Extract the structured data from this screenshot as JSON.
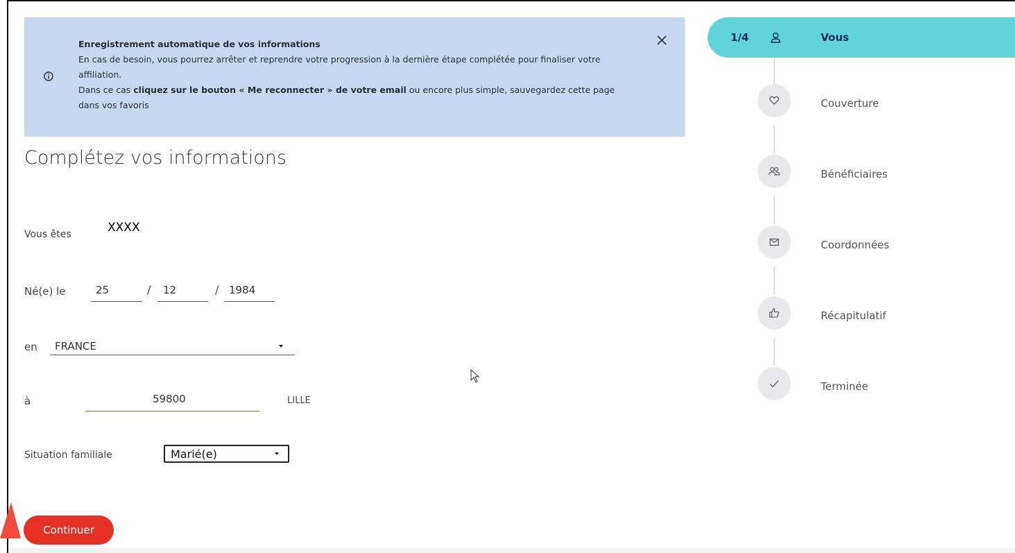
{
  "banner": {
    "title": "Enregistrement automatique de vos informations",
    "line1": "En cas de besoin, vous pourrez arrêter et reprendre votre progression à la dernière étape complétée pour finaliser votre affiliation.",
    "line2_prefix": "Dans ce cas ",
    "line2_bold": "cliquez sur le bouton « Me reconnecter » de votre email",
    "line2_suffix": " ou encore plus simple, sauvegardez cette page dans vos favoris"
  },
  "form": {
    "title": "Complétez vos informations",
    "vous_etes_label": "Vous êtes",
    "vous_etes_value": "XXXX",
    "ne_le_label": "Né(e) le",
    "day": "25",
    "month": "12",
    "year": "1984",
    "slash": "/",
    "en_label": "en",
    "country": "FRANCE",
    "a_label": "à",
    "postal_code": "59800",
    "city": "LILLE",
    "situation_label": "Situation familiale",
    "situation_value": "Marié(e)"
  },
  "buttons": {
    "continue": "Continuer"
  },
  "stepper": {
    "current": "1/4",
    "active_step": "Vous",
    "steps": [
      "Couverture",
      "Bénéficiaires",
      "Coordonnées",
      "Récapitulatif",
      "Terminée"
    ]
  },
  "icons": {
    "info": "info-icon",
    "close": "close-icon",
    "user": "user-icon",
    "heart": "heart-icon",
    "people": "people-icon",
    "mail": "mail-icon",
    "thumbs_up": "thumbs-up-icon",
    "check": "check-icon"
  },
  "colors": {
    "banner_bg": "#c7d7f0",
    "active_step_bg": "#5fd3dc",
    "active_step_text": "#1e2a63",
    "primary_button": "#e53125",
    "annotation_arrow": "#f04b3c"
  }
}
